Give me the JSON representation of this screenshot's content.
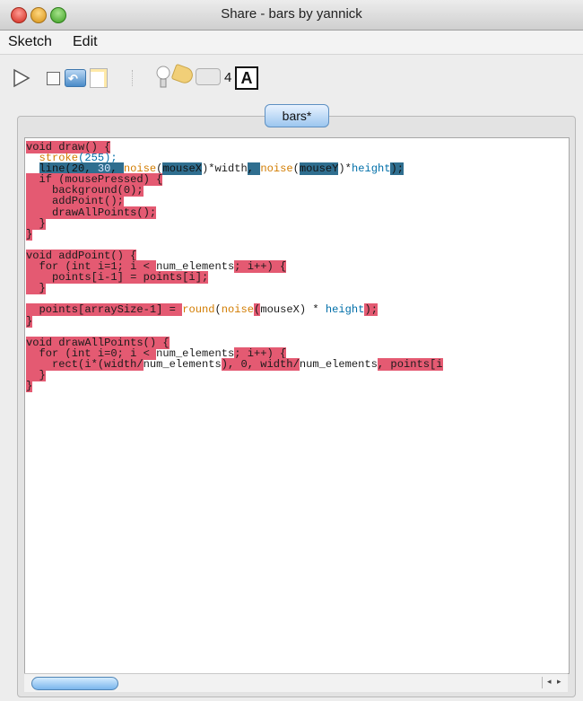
{
  "window": {
    "title": "Share - bars by yannick"
  },
  "menubar": {
    "items": [
      "Sketch",
      "Edit"
    ]
  },
  "toolbar": {
    "run_icon": "play-icon",
    "stop_icon": "stop-icon",
    "share_icon": "share-icon",
    "new_icon": "new-icon",
    "bulb_icon": "bulb-icon",
    "tag_icon": "tag-icon",
    "comment_icon": "comment-icon",
    "count": "4",
    "font_label": "A"
  },
  "tab": {
    "label": "bars*"
  },
  "editor": {
    "lines": [
      [
        [
          "void draw() {",
          "red"
        ]
      ],
      [
        [
          "  ",
          "plain"
        ],
        [
          "stroke",
          "orange"
        ],
        [
          "(255);",
          "blue"
        ]
      ],
      [
        [
          "  ",
          "plain"
        ],
        [
          "line(20, ",
          "teal"
        ],
        [
          "30",
          "tealblue"
        ],
        [
          ", ",
          "teal"
        ],
        [
          "noise",
          "orange"
        ],
        [
          "(",
          "plain"
        ],
        [
          "mouseX",
          "teal"
        ],
        [
          ")*width",
          "plain"
        ],
        [
          ", ",
          "teal"
        ],
        [
          "noise",
          "orange"
        ],
        [
          "(",
          "plain"
        ],
        [
          "mouseY",
          "teal"
        ],
        [
          ")*",
          "plain"
        ],
        [
          "height",
          "blue"
        ],
        [
          ");",
          "teal"
        ]
      ],
      [
        [
          "  if (mousePressed) {",
          "red"
        ]
      ],
      [
        [
          "    background(0);",
          "red"
        ]
      ],
      [
        [
          "    addPoint();",
          "red"
        ]
      ],
      [
        [
          "    drawAllPoints();",
          "red"
        ]
      ],
      [
        [
          "  }",
          "red"
        ]
      ],
      [
        [
          "}",
          "red"
        ]
      ],
      [
        [
          "",
          "plain"
        ]
      ],
      [
        [
          "void addPoint() {",
          "red"
        ]
      ],
      [
        [
          "  for (int i=1; i < ",
          "red"
        ],
        [
          "num_elements",
          "plain"
        ],
        [
          "; i++) {",
          "red"
        ]
      ],
      [
        [
          "    points[i-1] = points[i];",
          "red"
        ]
      ],
      [
        [
          "  }",
          "red"
        ]
      ],
      [
        [
          "",
          "plain"
        ]
      ],
      [
        [
          "  points[arraySize-1] = ",
          "red"
        ],
        [
          "round",
          "orange"
        ],
        [
          "(",
          "plain"
        ],
        [
          "noise",
          "orange"
        ],
        [
          "(",
          "red"
        ],
        [
          "mouseX) * ",
          "plain"
        ],
        [
          "height",
          "blue"
        ],
        [
          ");",
          "red"
        ]
      ],
      [
        [
          "}",
          "red"
        ]
      ],
      [
        [
          "",
          "plain"
        ]
      ],
      [
        [
          "void drawAllPoints() {",
          "red"
        ]
      ],
      [
        [
          "  for (int i=0; i < ",
          "red"
        ],
        [
          "num_elements",
          "plain"
        ],
        [
          "; i++) {",
          "red"
        ]
      ],
      [
        [
          "    rect(i*(width/",
          "red"
        ],
        [
          "num_elements",
          "plain"
        ],
        [
          "), 0, width/",
          "red"
        ],
        [
          "num_elements",
          "plain"
        ],
        [
          ", points[i",
          "red"
        ]
      ],
      [
        [
          "  }",
          "red"
        ]
      ],
      [
        [
          "}",
          "red"
        ]
      ]
    ]
  },
  "scrollbar": {
    "left_arrow": "◂",
    "right_arrow": "▸"
  }
}
